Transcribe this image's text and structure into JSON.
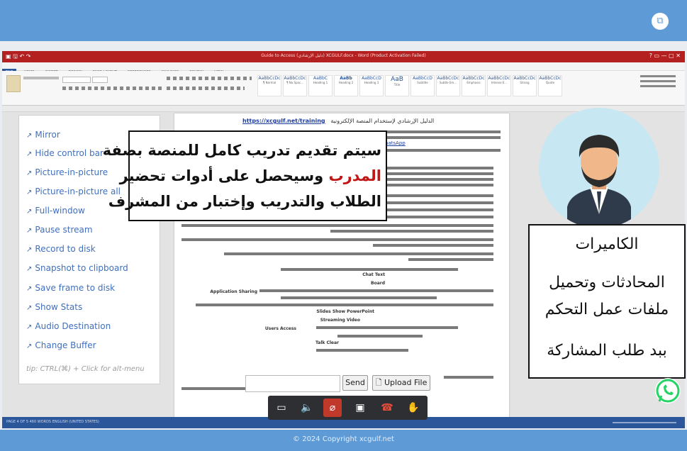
{
  "word": {
    "window_title": "Guide to Access (دليل الإرشادي) XCGULF.docx - Word (Product Activation Failed)",
    "ribbon_tabs": [
      "FILE",
      "HOME",
      "INSERT",
      "DESIGN",
      "PAGE LAYOUT",
      "REFERENCES",
      "MAILINGS",
      "REVIEW",
      "VIEW"
    ],
    "style_names": [
      "¶ Normal",
      "¶ No Spac...",
      "Heading 1",
      "Heading 2",
      "Heading 3",
      "Title",
      "Subtitle",
      "Subtle Em...",
      "Emphasis",
      "Intense E...",
      "Strong",
      "Quote"
    ],
    "style_samples": [
      "AaBbCcDc",
      "AaBbCcDc",
      "AaBbC",
      "AaBb",
      "AaBbCcD",
      "AaB",
      "AaBbCcD",
      "AaBbCcDc",
      "AaBbCcDc",
      "AaBbCcDc",
      "AaBbCcDc",
      "AaBbCcDc"
    ],
    "status_text": "PAGE 4 OF 5    460 WORDS    ENGLISH (UNITED STATES)",
    "doc_heading_ar": "الدليل الإرشادي لإستخدام المنصة الإلكترونية",
    "doc_heading_link": "https://xcgulf.net/training",
    "doc_whatsapp_link": "WhatsApp",
    "doc_english_lines": [
      "Chat Text",
      "Board",
      "Application Sharing",
      "Slides Show PowerPoint",
      "Streaming Video",
      "Users Access",
      "Talk Clear"
    ]
  },
  "menu": {
    "items": [
      "Mirror",
      "Hide control bar",
      "Picture-in-picture",
      "Picture-in-picture all",
      "Full-window",
      "Pause stream",
      "Record to disk",
      "Snapshot to clipboard",
      "Save frame to disk",
      "Show Stats",
      "Audio Destination",
      "Change Buffer"
    ],
    "tip": "tip: CTRL(⌘) + Click for alt-menu"
  },
  "callout": {
    "line1": "سيتم تقديم تدريب كامل للمنصة بصفة",
    "line2_red": "المدرب",
    "line2_rest": " وسيحصل على أدوات تحضير",
    "line3": "الطلاب والتدريب وإختبار من المشرف"
  },
  "right_box": {
    "line1": "الكاميرات",
    "line2": "المحادثات وتحميل",
    "line3": "ملفات عمل التحكم",
    "line4": "ببد طلب المشاركة"
  },
  "chat": {
    "send_label": "Send",
    "upload_label": "Upload File"
  },
  "callbar": {
    "icons": [
      "chat-icon",
      "speaker-icon",
      "mic-muted-icon",
      "camera-icon",
      "hangup-icon",
      "raise-hand-icon"
    ],
    "muted_color": "#c0392b"
  },
  "footer": {
    "copyright": "© 2024 Copyright xcgulf.net"
  },
  "colors": {
    "header_blue": "#5d9ad6",
    "word_red": "#b4201f",
    "word_blue": "#2b579a",
    "link_blue": "#3f6fbf",
    "whatsapp_green": "#25d366"
  }
}
